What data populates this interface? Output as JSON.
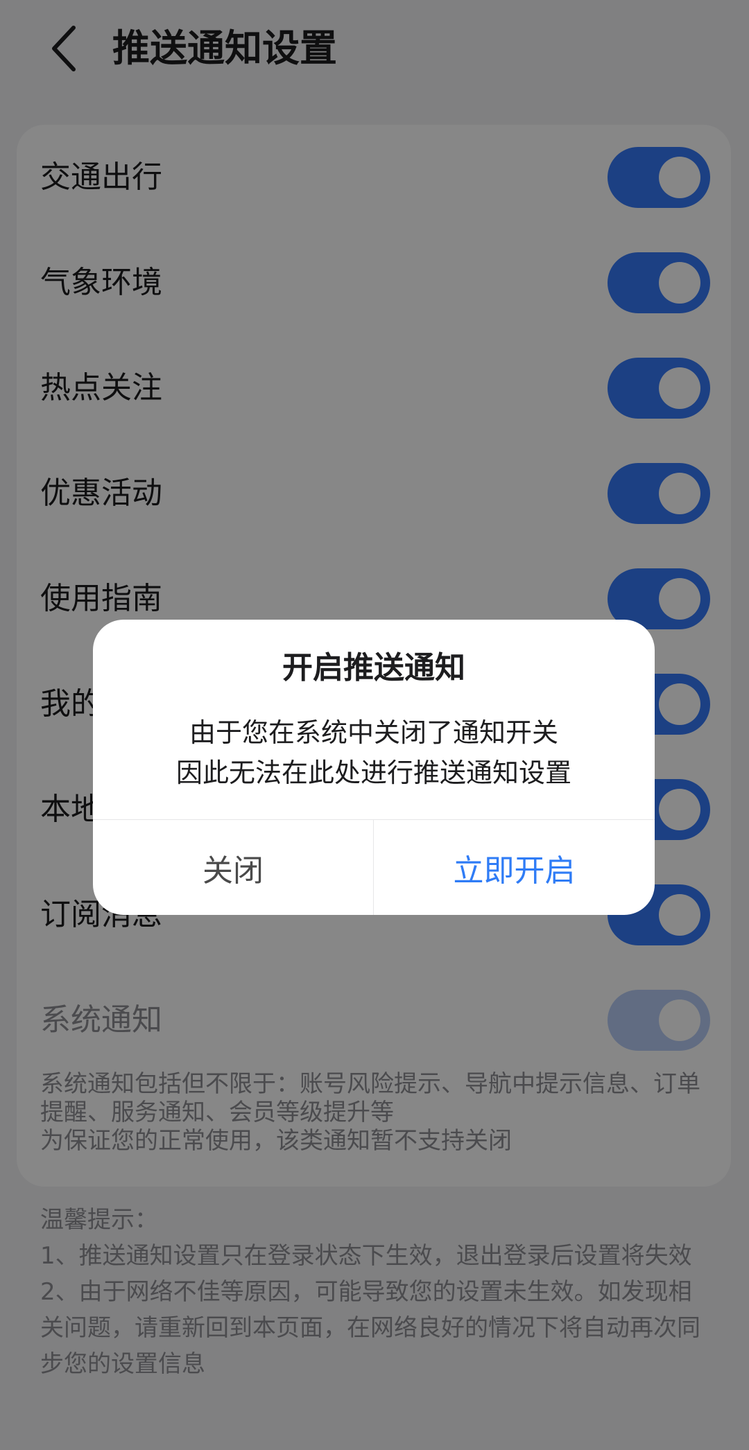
{
  "header": {
    "title": "推送通知设置",
    "back_icon": "chevron-left-icon"
  },
  "settings": {
    "items": [
      {
        "label": "交通出行",
        "enabled": true
      },
      {
        "label": "气象环境",
        "enabled": true
      },
      {
        "label": "热点关注",
        "enabled": true
      },
      {
        "label": "优惠活动",
        "enabled": true
      },
      {
        "label": "使用指南",
        "enabled": true
      },
      {
        "label": "我的",
        "enabled": true
      },
      {
        "label": "本地",
        "enabled": true
      },
      {
        "label": "订阅消息",
        "enabled": true
      }
    ],
    "system": {
      "label": "系统通知",
      "enabled": true,
      "locked": true,
      "description_1": "系统通知包括但不限于：账号风险提示、导航中提示信息、订单提醒、服务通知、会员等级提升等",
      "description_2": "为保证您的正常使用，该类通知暂不支持关闭"
    }
  },
  "tips": {
    "title": "温馨提示：",
    "line_1": "1、推送通知设置只在登录状态下生效，退出登录后设置将失效",
    "line_2": "2、由于网络不佳等原因，可能导致您的设置未生效。如发现相关问题，请重新回到本页面，在网络良好的情况下将自动再次同步您的设置信息"
  },
  "dialog": {
    "title": "开启推送通知",
    "message_line_1": "由于您在系统中关闭了通知开关",
    "message_line_2": "因此无法在此处进行推送通知设置",
    "close_label": "关闭",
    "open_label": "立即开启"
  },
  "colors": {
    "accent": "#3679f8",
    "toggle_disabled": "#b7cdf5",
    "dialog_primary": "#2f7cf6",
    "overlay": "rgba(0,0,0,0.47)"
  }
}
